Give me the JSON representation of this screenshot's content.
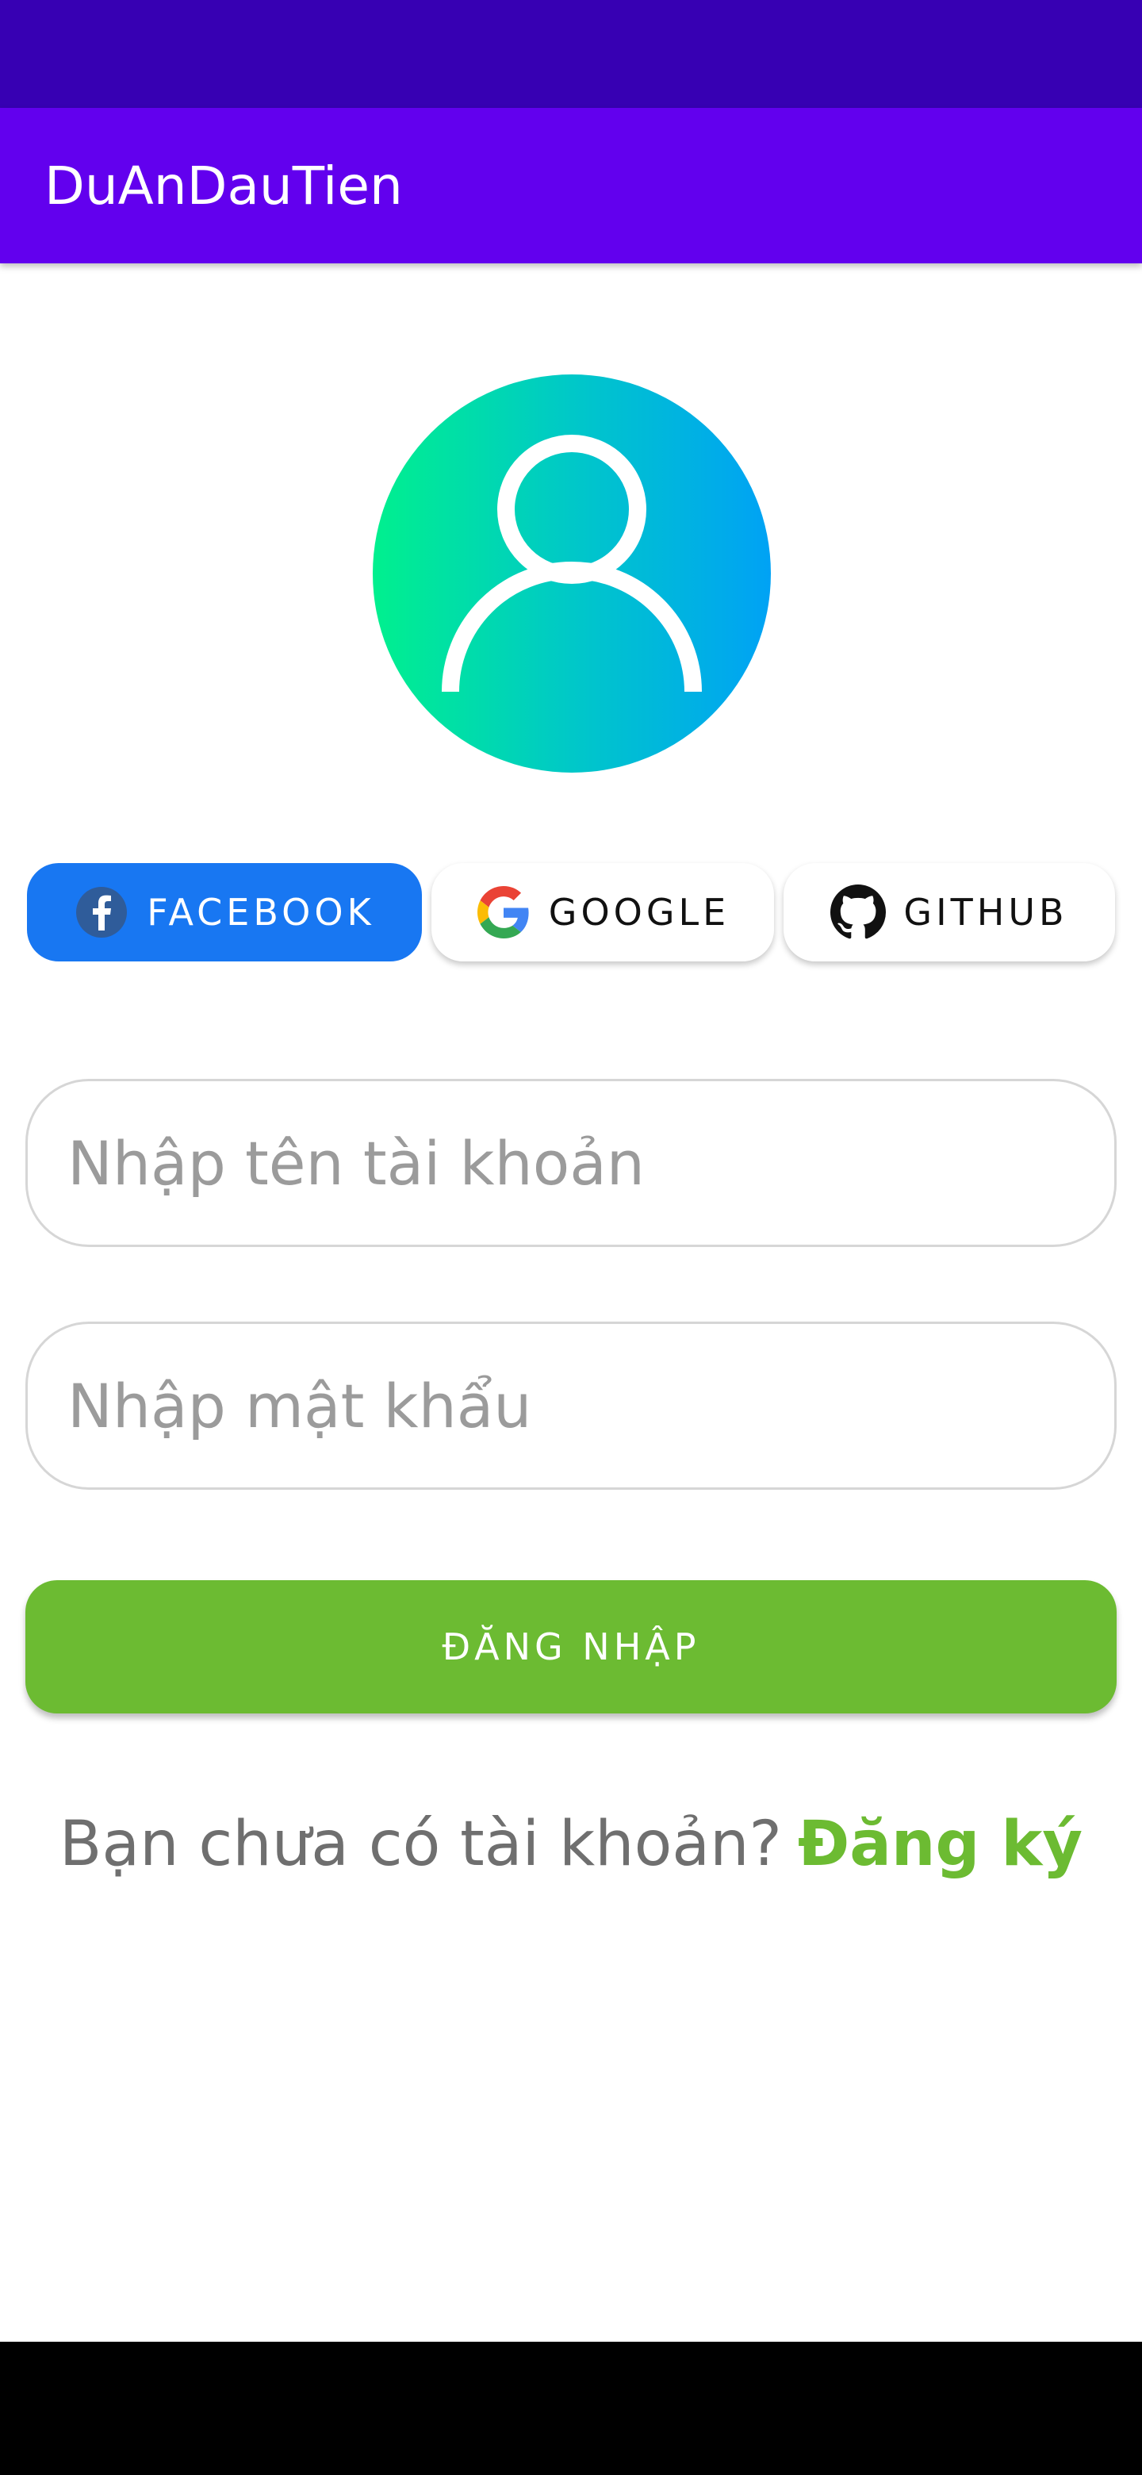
{
  "app": {
    "title": "DuAnDauTien"
  },
  "social_login": {
    "facebook_label": "FACEBOOK",
    "google_label": "GOOGLE",
    "github_label": "GITHUB"
  },
  "form": {
    "username_placeholder": "Nhập tên tài khoản",
    "username_value": "",
    "password_placeholder": "Nhập mật khẩu",
    "password_value": "",
    "login_label": "ĐĂNG NHẬP"
  },
  "signup": {
    "prompt": "Bạn chưa có tài khoản?",
    "link_label": "Đăng ký"
  },
  "icons": {
    "avatar": "user-avatar-icon",
    "facebook": "facebook-icon",
    "google": "google-icon",
    "github": "github-icon"
  },
  "colors": {
    "status_bar": "#3700b3",
    "app_bar": "#6200ee",
    "facebook": "#1877f2",
    "primary_green": "#6cbb32",
    "nav_bar": "#000000"
  }
}
